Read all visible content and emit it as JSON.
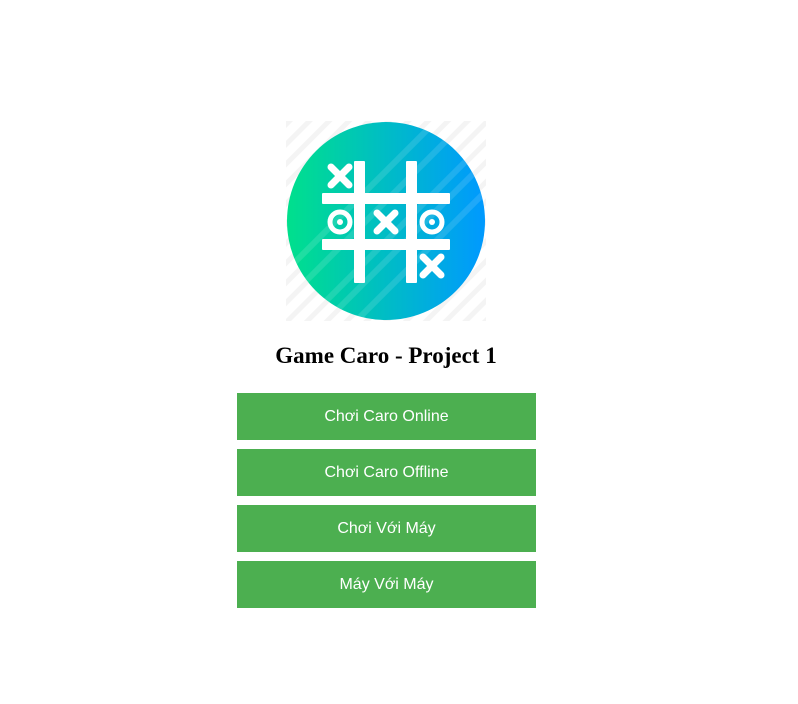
{
  "app": {
    "title": "Game Caro - Project 1"
  },
  "logo": {
    "icon": "tic-tac-toe-icon",
    "gradient_start": "#00e08c",
    "gradient_end": "#0099ff"
  },
  "menu": {
    "button_color": "#4caf50",
    "items": [
      {
        "label": "Chơi Caro Online"
      },
      {
        "label": "Chơi Caro Offline"
      },
      {
        "label": "Chơi Với Máy"
      },
      {
        "label": "Máy Với Máy"
      }
    ]
  }
}
